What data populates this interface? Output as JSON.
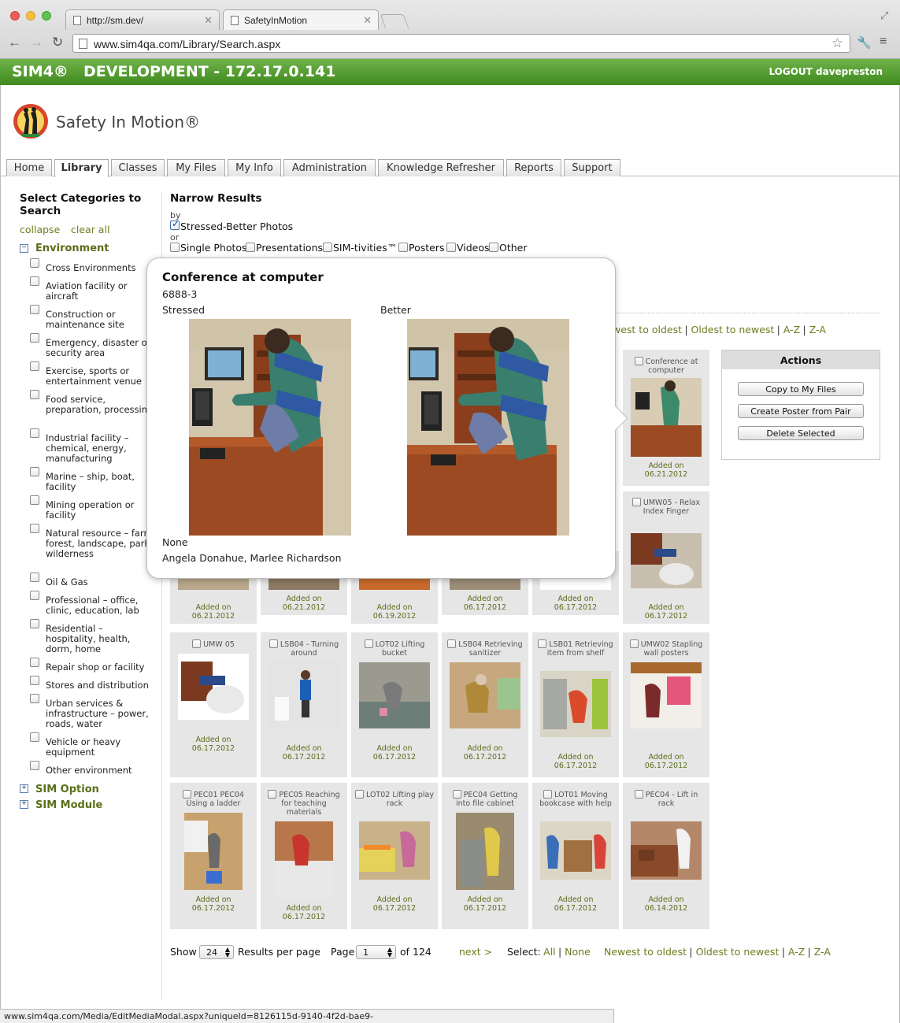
{
  "browser": {
    "tabs": [
      {
        "label": "http://sm.dev/"
      },
      {
        "label": "SafetyInMotion"
      }
    ],
    "url": "www.sim4qa.com/Library/Search.aspx",
    "status_url": "www.sim4qa.com/Media/EditMediaModal.aspx?uniqueId=8126115d-9140-4f2d-bae9-9defefc87baf&TB_iframe=true&height=500&width=775"
  },
  "header": {
    "product": "SIM4®",
    "environment": "DEVELOPMENT - 172.17.0.141",
    "logout": "LOGOUT davepreston",
    "brand": "Safety In Motion®"
  },
  "nav": [
    "Home",
    "Library",
    "Classes",
    "My Files",
    "My Info",
    "Administration",
    "Knowledge Refresher",
    "Reports",
    "Support"
  ],
  "sidebar": {
    "title": "Select Categories to Search",
    "collapse": "collapse",
    "clear_all": "clear all",
    "section_environment": "Environment",
    "categories": [
      "Cross Environments",
      "Aviation facility or aircraft",
      "Construction or maintenance site",
      "Emergency, disaster or security area",
      "Exercise, sports or entertainment venue",
      "Food service, preparation, processing",
      "Industrial facility – chemical, energy, manufacturing",
      "Marine – ship, boat, facility",
      "Mining operation or facility",
      "Natural resource – farm, forest, landscape, park, wilderness",
      "Oil & Gas",
      "Professional – office, clinic, education, lab",
      "Residential – hospitality, health, dorm, home",
      "Repair shop or facility",
      "Stores and distribution",
      "Urban services & infrastructure – power, roads, water",
      "Vehicle or heavy equipment",
      "Other environment"
    ],
    "section_option": "SIM Option",
    "section_module": "SIM Module"
  },
  "narrow": {
    "title": "Narrow Results",
    "by": "by",
    "or": "or",
    "primary": "Stressed-Better Photos",
    "types": [
      "Single Photos",
      "Presentations",
      "SIM-tivities™",
      "Posters",
      "Videos",
      "Other"
    ]
  },
  "sort": {
    "partial_newest": "west to oldest",
    "newest": "Newest to oldest",
    "oldest": "Oldest to newest",
    "az": "A-Z",
    "za": "Z-A"
  },
  "popup": {
    "title": "Conference at computer",
    "code": "6888-3",
    "stressed": "Stressed",
    "better": "Better",
    "none": "None",
    "people": "Angela Donahue, Marlee Richardson"
  },
  "actions": {
    "title": "Actions",
    "copy": "Copy to My Files",
    "poster": "Create Poster from Pair",
    "delete": "Delete Selected"
  },
  "grid": {
    "added_label": "Added on",
    "row1": [
      {
        "title": "Conference at computer",
        "date": "06.21.2012"
      }
    ],
    "row2": [
      {
        "title": "",
        "date": "06.21.2012"
      },
      {
        "title": "",
        "date": "06.21.2012"
      },
      {
        "title": "",
        "date": "06.19.2012"
      },
      {
        "title": "",
        "date": "06.17.2012"
      },
      {
        "title": "",
        "date": "06.17.2012"
      },
      {
        "title": "UMW05 - Relax Index Finger",
        "date": "06.17.2012"
      }
    ],
    "row3": [
      {
        "title": "UMW 05",
        "date": "06.17.2012"
      },
      {
        "title": "LSB04 - Turning around",
        "date": "06.17.2012"
      },
      {
        "title": "LOT02 Lifting bucket",
        "date": "06.17.2012"
      },
      {
        "title": "LSB04 Retrieving sanitizer",
        "date": "06.17.2012"
      },
      {
        "title": "LSB01 Retrieving item from shelf",
        "date": "06.17.2012"
      },
      {
        "title": "UMW02 Stapling wall posters",
        "date": "06.17.2012"
      }
    ],
    "row4": [
      {
        "title": "PEC01 PEC04 Using a ladder",
        "date": "06.17.2012"
      },
      {
        "title": "PEC05 Reaching for teaching materials",
        "date": "06.17.2012"
      },
      {
        "title": "LOT02 Lifting play rack",
        "date": "06.17.2012"
      },
      {
        "title": "PEC04 Getting into file cabinet",
        "date": "06.17.2012"
      },
      {
        "title": "LOT01 Moving bookcase with help",
        "date": "06.17.2012"
      },
      {
        "title": "PEC04 - Lift in rack",
        "date": "06.14.2012"
      }
    ]
  },
  "pager": {
    "show": "Show",
    "per_page_value": "24",
    "per_page_label": "Results per page",
    "page": "Page",
    "page_value": "1",
    "of": "of 124",
    "next": "next >",
    "select": "Select:",
    "all": "All",
    "none": "None"
  }
}
